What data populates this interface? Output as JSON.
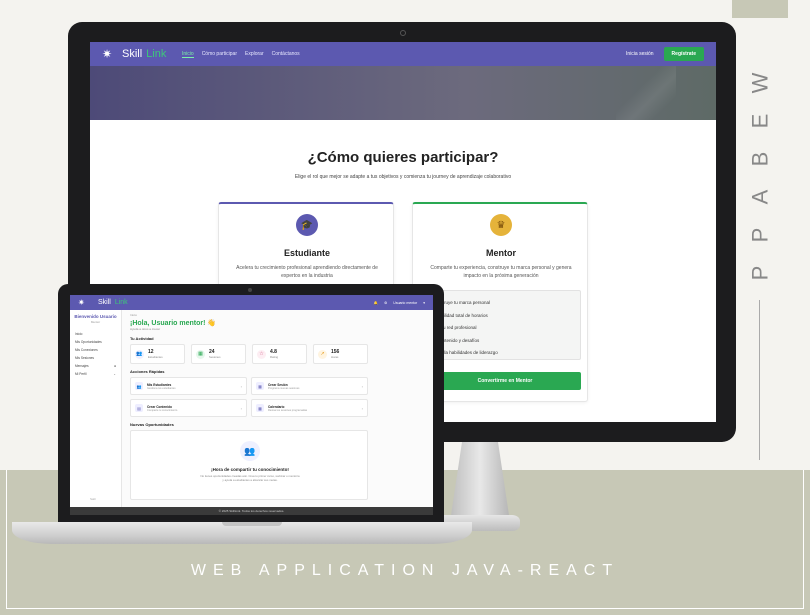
{
  "side_label": [
    "W",
    "E",
    "B",
    "A",
    "P",
    "P"
  ],
  "bottom_title": "WEB APPLICATION JAVA-REACT",
  "brand": {
    "name_a": "Skill",
    "name_b": "Link"
  },
  "monitor": {
    "nav_links": [
      "Inicio",
      "Cómo participar",
      "Explorar",
      "Contáctanos"
    ],
    "login": "Inicia sesión",
    "register": "Regístrate",
    "title": "¿Cómo quieres participar?",
    "subtitle": "Elige el rol que mejor se adapte a tus objetivos y comienza tu journey de aprendizaje colaborativo",
    "student": {
      "title": "Estudiante",
      "desc": "Acelera tu crecimiento profesional aprendiendo directamente de expertos en la industria"
    },
    "mentor": {
      "title": "Mentor",
      "desc": "Comparte tu experiencia, construye tu marca personal y genera impacto en la próxima generación",
      "features": [
        "nstruye tu marca personal",
        "xibilidad total de horarios",
        "a tu red profesional",
        "contenido y desafíos",
        "rrolla habilidades de liderazgo"
      ],
      "button": "Convertirme en Mentor"
    }
  },
  "laptop": {
    "nav_user": "Usuario mentor",
    "sidebar": {
      "welcome": "Bienvenido Usuario",
      "role": "Mentor",
      "items": [
        "Inicio",
        "Mis Oportunidades",
        "Mis Conexiones",
        "Mis Sesiones",
        "Mensajes",
        "Mi Perfil"
      ],
      "exit": "Salir"
    },
    "crumb": "Inicio",
    "hello": "¡Hola, Usuario mentor! 👋",
    "hello_sub": "Ayuda a otros a crecer",
    "activity_title": "Tu Actividad",
    "stats": [
      {
        "value": "12",
        "label": "Estudiantes"
      },
      {
        "value": "24",
        "label": "Sesiones"
      },
      {
        "value": "4.8",
        "label": "Rating"
      },
      {
        "value": "156",
        "label": "Horas"
      }
    ],
    "quick_title": "Acciones Rápidas",
    "quick": [
      {
        "title": "Mis Estudiantes",
        "sub": "Gestiona tus estudiantes"
      },
      {
        "title": "Crear Sesión",
        "sub": "Programa nuevas sesiones"
      },
      {
        "title": "Crear Contenido",
        "sub": "Comparte tu conocimiento"
      },
      {
        "title": "Calendario",
        "sub": "Revisa tus sesiones programadas"
      }
    ],
    "opp_title": "Nuevas Oportunidades",
    "opp_heading": "¡Hora de compartir tu conocimiento!",
    "opp_text": "No tienes oportunidades creadas aún. Crea tu primer curso, webinar o mentoría y ayuda a estudiantes a alcanzar sus metas.",
    "footer": "© 2025 SkillLink. Todos los derechos reservados."
  }
}
